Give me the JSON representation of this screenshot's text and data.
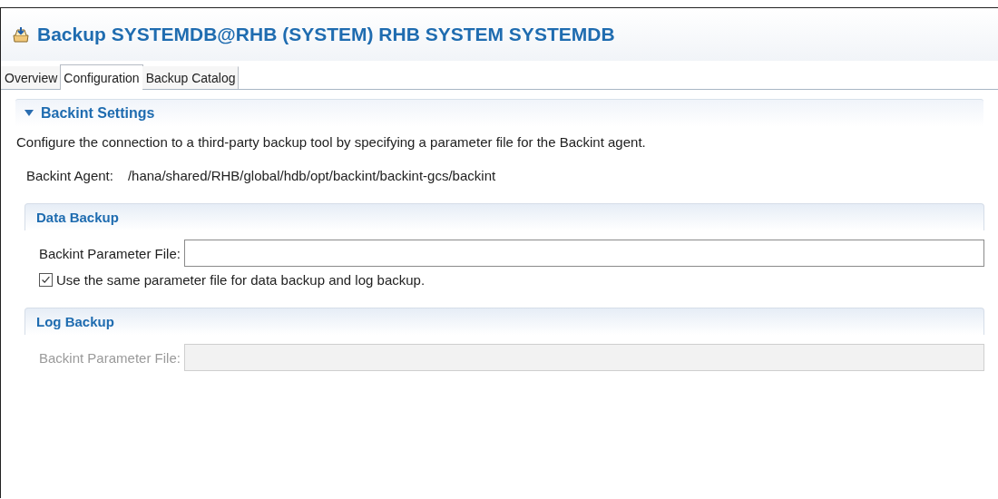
{
  "editor": {
    "title": "Backup SYSTEMDB@RHB (SYSTEM) RHB SYSTEM SYSTEMDB"
  },
  "tabs": [
    {
      "label": "Overview",
      "selected": false
    },
    {
      "label": "Configuration",
      "selected": true
    },
    {
      "label": "Backup Catalog",
      "selected": false
    }
  ],
  "section": {
    "title": "Backint Settings",
    "expanded": true,
    "description": "Configure the connection to a third-party backup tool by specifying a parameter file for the Backint agent.",
    "agent_label": "Backint Agent:",
    "agent_path": "/hana/shared/RHB/global/hdb/opt/backint/backint-gcs/backint",
    "groups": [
      {
        "title": "Data Backup",
        "field_label": "Backint Parameter File:",
        "disabled": false,
        "checkbox": {
          "label": "Use the same parameter file for data backup and log backup.",
          "checked": true
        }
      },
      {
        "title": "Log Backup",
        "field_label": "Backint Parameter File:",
        "disabled": true
      }
    ]
  }
}
